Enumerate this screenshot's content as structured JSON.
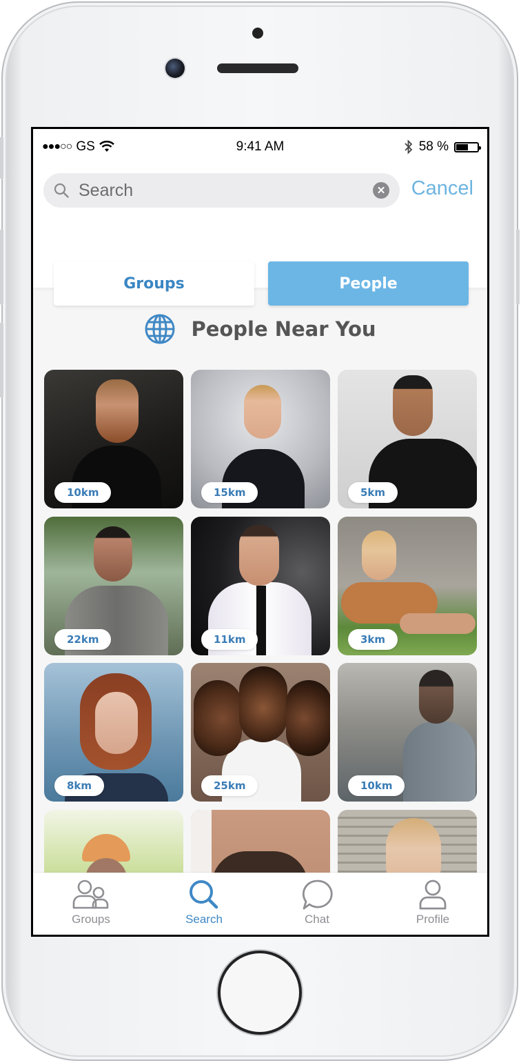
{
  "status_bar": {
    "signal": "●●●○○",
    "carrier": "GS",
    "time": "9:41 AM",
    "battery": "58 %",
    "battery_level": 0.58
  },
  "search": {
    "placeholder": "Search",
    "value": "",
    "cancel_label": "Cancel"
  },
  "segments": [
    {
      "label": "Groups",
      "selected": false
    },
    {
      "label": "People",
      "selected": true
    }
  ],
  "section": {
    "title": "People Near You",
    "icon": "globe-icon"
  },
  "people": [
    {
      "distance": "10km"
    },
    {
      "distance": "15km"
    },
    {
      "distance": "5km"
    },
    {
      "distance": "22km"
    },
    {
      "distance": "11km"
    },
    {
      "distance": "3km"
    },
    {
      "distance": "8km"
    },
    {
      "distance": "25km"
    },
    {
      "distance": "10km"
    },
    {
      "distance": ""
    },
    {
      "distance": ""
    },
    {
      "distance": ""
    }
  ],
  "tabs": [
    {
      "label": "Groups",
      "icon": "groups-icon",
      "active": false
    },
    {
      "label": "Search",
      "icon": "search-icon",
      "active": true
    },
    {
      "label": "Chat",
      "icon": "chat-icon",
      "active": false
    },
    {
      "label": "Profile",
      "icon": "profile-icon",
      "active": false
    }
  ],
  "colors": {
    "accent": "#6cb6e6",
    "accent_text": "#3a86c3",
    "inactive_tab": "#8e8e93"
  }
}
